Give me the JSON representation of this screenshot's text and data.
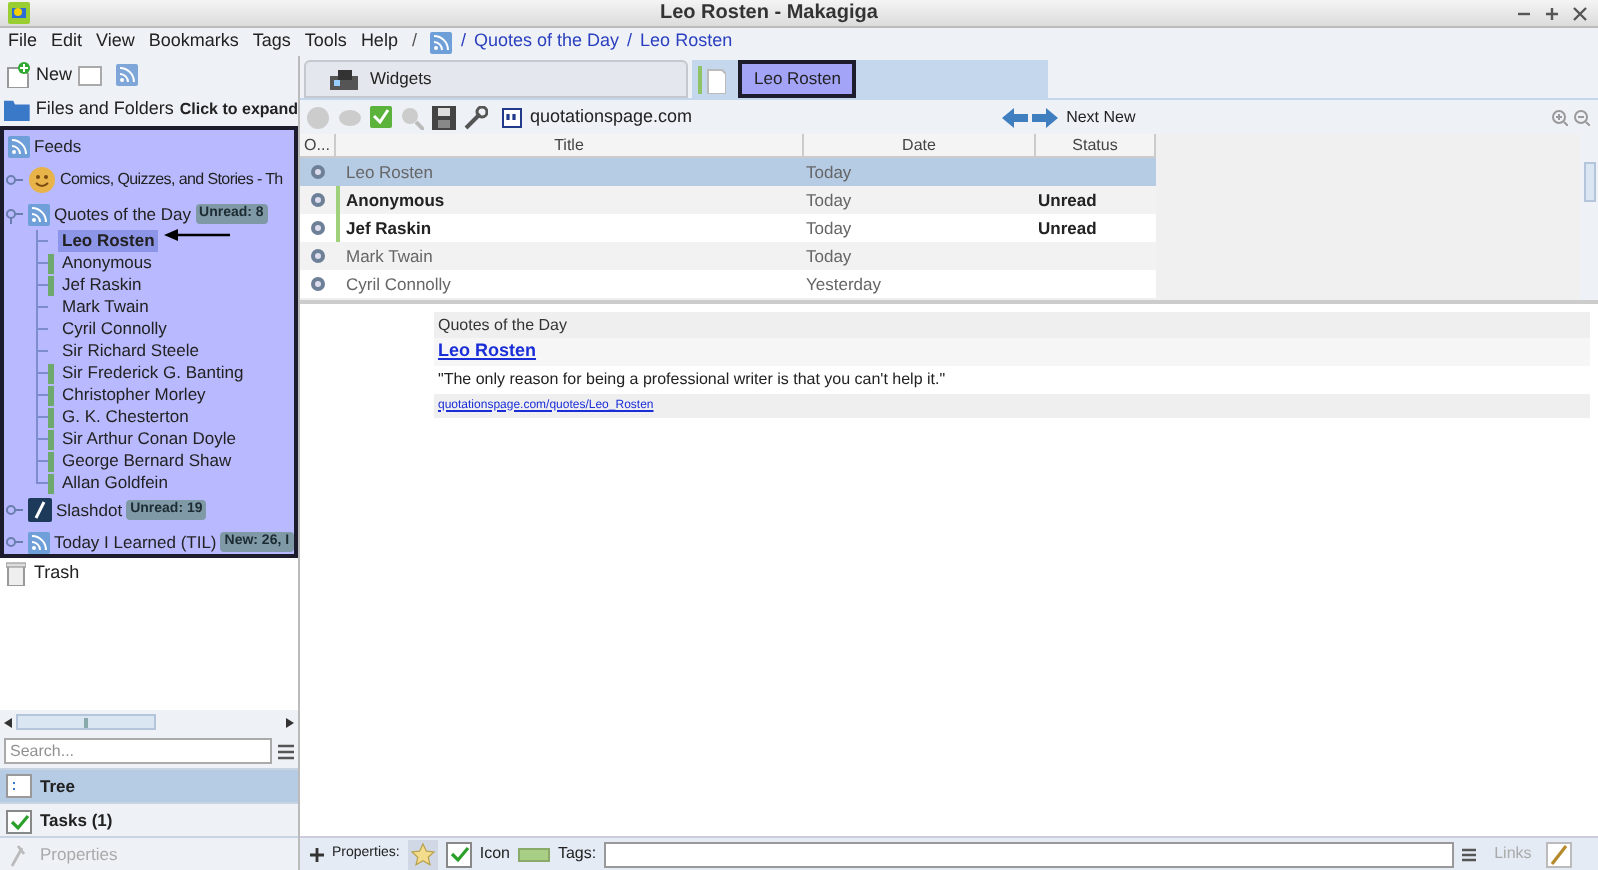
{
  "window": {
    "title": "Leo Rosten - Makagiga"
  },
  "menu": [
    "File",
    "Edit",
    "View",
    "Bookmarks",
    "Tags",
    "Tools",
    "Help"
  ],
  "breadcrumb": {
    "separator": "/",
    "items": [
      "Quotes of the Day",
      "Leo Rosten"
    ]
  },
  "left_toolbar": {
    "new_label": "New"
  },
  "files_and_folders": {
    "label": "Files and Folders",
    "hint": "Click to expand"
  },
  "tree": [
    {
      "label": "Feeds",
      "kind": "feeds",
      "children": [
        {
          "label": "Comics, Quizzes, and Stories - Th",
          "kind": "smiley",
          "expanded": false
        },
        {
          "label": "Quotes of the Day",
          "kind": "feed",
          "expanded": true,
          "badge": "Unread: 8",
          "children": [
            {
              "label": "Leo Rosten",
              "selected": true,
              "unread": false
            },
            {
              "label": "Anonymous",
              "selected": false,
              "unread": true
            },
            {
              "label": "Jef Raskin",
              "selected": false,
              "unread": true
            },
            {
              "label": "Mark Twain",
              "selected": false,
              "unread": false
            },
            {
              "label": "Cyril Connolly",
              "selected": false,
              "unread": false
            },
            {
              "label": "Sir Richard Steele",
              "selected": false,
              "unread": false
            },
            {
              "label": "Sir Frederick G. Banting",
              "selected": false,
              "unread": true
            },
            {
              "label": "Christopher Morley",
              "selected": false,
              "unread": true
            },
            {
              "label": "G. K. Chesterton",
              "selected": false,
              "unread": true
            },
            {
              "label": "Sir Arthur Conan Doyle",
              "selected": false,
              "unread": true
            },
            {
              "label": "George Bernard Shaw",
              "selected": false,
              "unread": true
            },
            {
              "label": "Allan Goldfein",
              "selected": false,
              "unread": true
            }
          ]
        },
        {
          "label": "Slashdot",
          "kind": "slashdot",
          "expanded": false,
          "badge": "Unread: 19"
        },
        {
          "label": "Today I Learned (TIL)",
          "kind": "feed",
          "expanded": false,
          "badge": "New: 26, I"
        }
      ]
    },
    {
      "label": "Trash",
      "kind": "trash"
    }
  ],
  "search": {
    "placeholder": "Search..."
  },
  "side_tabs": [
    {
      "label": "Tree",
      "kind": "tree",
      "selected": true,
      "disabled": false
    },
    {
      "label": "Tasks (1)",
      "kind": "tasks",
      "selected": false,
      "disabled": false
    },
    {
      "label": "Properties",
      "kind": "properties",
      "selected": false,
      "disabled": true
    }
  ],
  "tabs": [
    {
      "label": "Widgets",
      "selected": false
    },
    {
      "label": "Leo Rosten",
      "selected": true
    }
  ],
  "feed_toolbar": {
    "site": "quotationspage.com",
    "next_label": "Next New"
  },
  "table": {
    "columns": [
      "O...",
      "Title",
      "Date",
      "Status"
    ],
    "rows": [
      {
        "title": "Leo Rosten",
        "date": "Today",
        "unread": false,
        "selected": true
      },
      {
        "title": "Anonymous",
        "date": "Today",
        "status": "Unread",
        "unread": true,
        "selected": false
      },
      {
        "title": "Jef Raskin",
        "date": "Today",
        "status": "Unread",
        "unread": true,
        "selected": false
      },
      {
        "title": "Mark Twain",
        "date": "Today",
        "unread": false,
        "selected": false
      },
      {
        "title": "Cyril Connolly",
        "date": "Yesterday",
        "unread": false,
        "selected": false
      }
    ]
  },
  "preview": {
    "feed": "Quotes of the Day",
    "title": "Leo Rosten",
    "text": "\"The only reason for being a professional writer is that you can't help it.\"",
    "link": "quotationspage.com/quotes/Leo_Rosten"
  },
  "bottom_bar": {
    "properties_label": "Properties:",
    "icon_label": "Icon",
    "tags_label": "Tags:",
    "links_label": "Links"
  }
}
